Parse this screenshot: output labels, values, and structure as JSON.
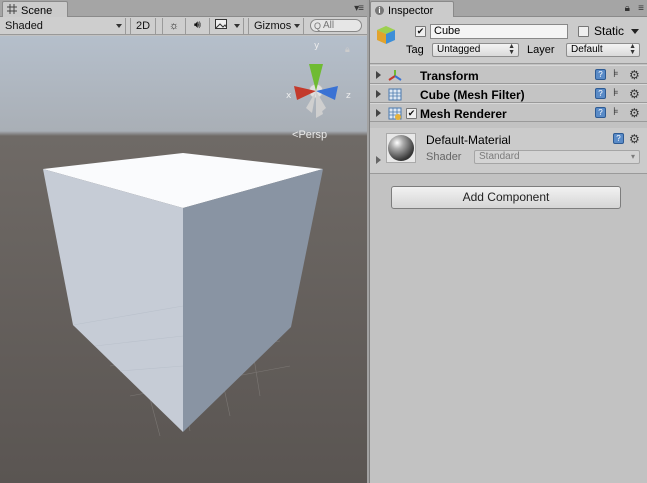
{
  "scene": {
    "tab_label": "Scene",
    "toolbar": {
      "draw_mode": "Shaded",
      "mode_2d": "2D",
      "gizmos": "Gizmos",
      "search_placeholder": "All"
    },
    "projection_label": "Persp",
    "gizmo_axes": {
      "x": "x",
      "y": "y",
      "z": "z"
    }
  },
  "inspector": {
    "tab_label": "Inspector",
    "object_name": "Cube",
    "active": true,
    "static_label": "Static",
    "tag_label": "Tag",
    "tag_value": "Untagged",
    "layer_label": "Layer",
    "layer_value": "Default",
    "components": [
      {
        "title": "Transform",
        "icon": "transform-icon",
        "has_checkbox": false
      },
      {
        "title": "Cube (Mesh Filter)",
        "icon": "mesh-filter-icon",
        "has_checkbox": false
      },
      {
        "title": "Mesh Renderer",
        "icon": "mesh-renderer-icon",
        "has_checkbox": true,
        "enabled": true
      }
    ],
    "material": {
      "name": "Default-Material",
      "shader_label": "Shader",
      "shader_value": "Standard"
    },
    "add_component_label": "Add Component"
  },
  "colors": {
    "panel_bg": "#c2c2c2",
    "x_axis": "#c33a2c",
    "y_axis": "#6fbb32",
    "z_axis": "#3a72d4"
  }
}
